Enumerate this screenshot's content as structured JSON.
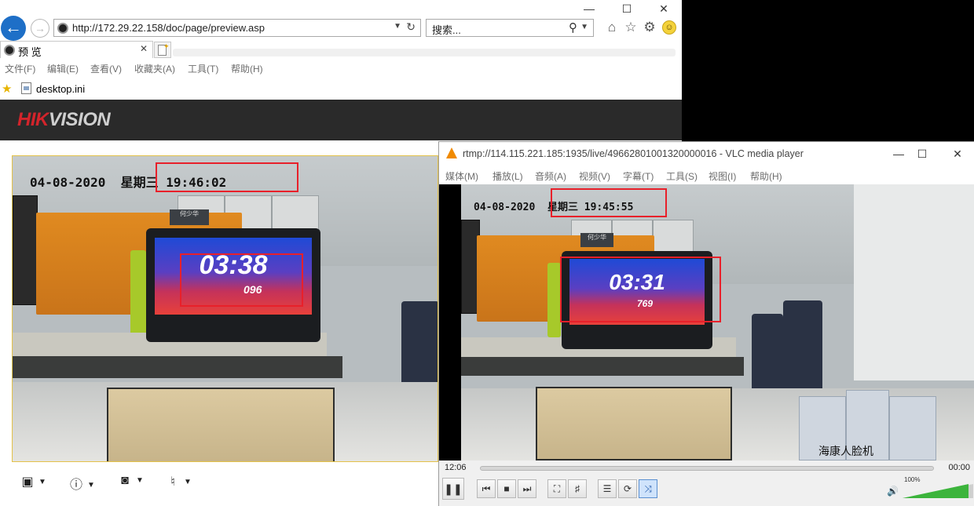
{
  "ie": {
    "address": "http://172.29.22.158/doc/page/preview.asp",
    "search_placeholder": "搜索...",
    "tab_title": "预 览",
    "menu": [
      "文件(F)",
      "编辑(E)",
      "查看(V)",
      "收藏夹(A)",
      "工具(T)",
      "帮助(H)"
    ],
    "favorite": "desktop.ini",
    "logo_red": "HIK",
    "logo_rest": "VISION",
    "osd_date": "04-08-2020",
    "osd_weekday": "星期三",
    "osd_time": "19:46:02",
    "screen_time": "03:38",
    "screen_ms": "096",
    "nameplate": "何少华"
  },
  "vlc": {
    "title": "rtmp://114.115.221.185:1935/live/49662801001320000016 - VLC media player",
    "menu": [
      "媒体(M)",
      "播放(L)",
      "音频(A)",
      "视频(V)",
      "字幕(T)",
      "工具(S)",
      "视图(I)",
      "帮助(H)"
    ],
    "osd_date": "04-08-2020",
    "osd_weekday": "星期三",
    "osd_time": "19:45:55",
    "screen_time": "03:31",
    "screen_ms": "769",
    "caption": "海康人脸机",
    "elapsed": "12:06",
    "total": "00:00",
    "volume": "100%",
    "volume_level": 1.0,
    "nameplate": "何少华"
  },
  "icons": {
    "back": "arrow-left-icon",
    "forward": "arrow-right-icon",
    "home": "home-icon",
    "star": "star-icon",
    "settings": "gear-icon",
    "smiley": "smiley-icon"
  },
  "colors": {
    "hik_red": "#d3242b",
    "annotation_red": "#e8202a",
    "vlc_orange": "#f08a00",
    "volume_green": "#3cb43c"
  }
}
